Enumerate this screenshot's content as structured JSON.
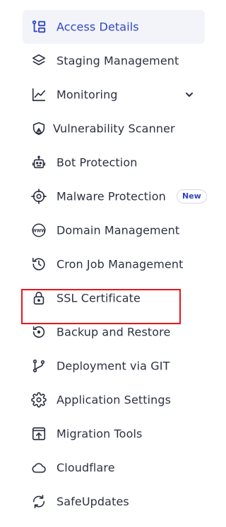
{
  "sidebar": {
    "items": [
      {
        "label": "Access Details",
        "icon": "access-details-icon",
        "active": true
      },
      {
        "label": "Staging Management",
        "icon": "layers-icon"
      },
      {
        "label": "Monitoring",
        "icon": "chart-line-icon",
        "expandable": true
      },
      {
        "label": "Vulnerability Scanner",
        "icon": "shield-warning-icon"
      },
      {
        "label": "Bot Protection",
        "icon": "robot-icon"
      },
      {
        "label": "Malware Protection",
        "icon": "crosshair-icon",
        "badge": "New"
      },
      {
        "label": "Domain Management",
        "icon": "www-globe-icon"
      },
      {
        "label": "Cron Job Management",
        "icon": "history-icon"
      },
      {
        "label": "SSL Certificate",
        "icon": "lock-icon"
      },
      {
        "label": "Backup and Restore",
        "icon": "restore-icon"
      },
      {
        "label": "Deployment via GIT",
        "icon": "git-branch-icon"
      },
      {
        "label": "Application Settings",
        "icon": "gear-icon"
      },
      {
        "label": "Migration Tools",
        "icon": "upload-box-icon"
      },
      {
        "label": "Cloudflare",
        "icon": "cloud-icon"
      },
      {
        "label": "SafeUpdates",
        "icon": "refresh-icon"
      }
    ]
  },
  "colors": {
    "accent": "#3046c5",
    "text": "#2b3140",
    "active_bg": "#f3f4f9",
    "highlight_border": "#e8151b"
  }
}
